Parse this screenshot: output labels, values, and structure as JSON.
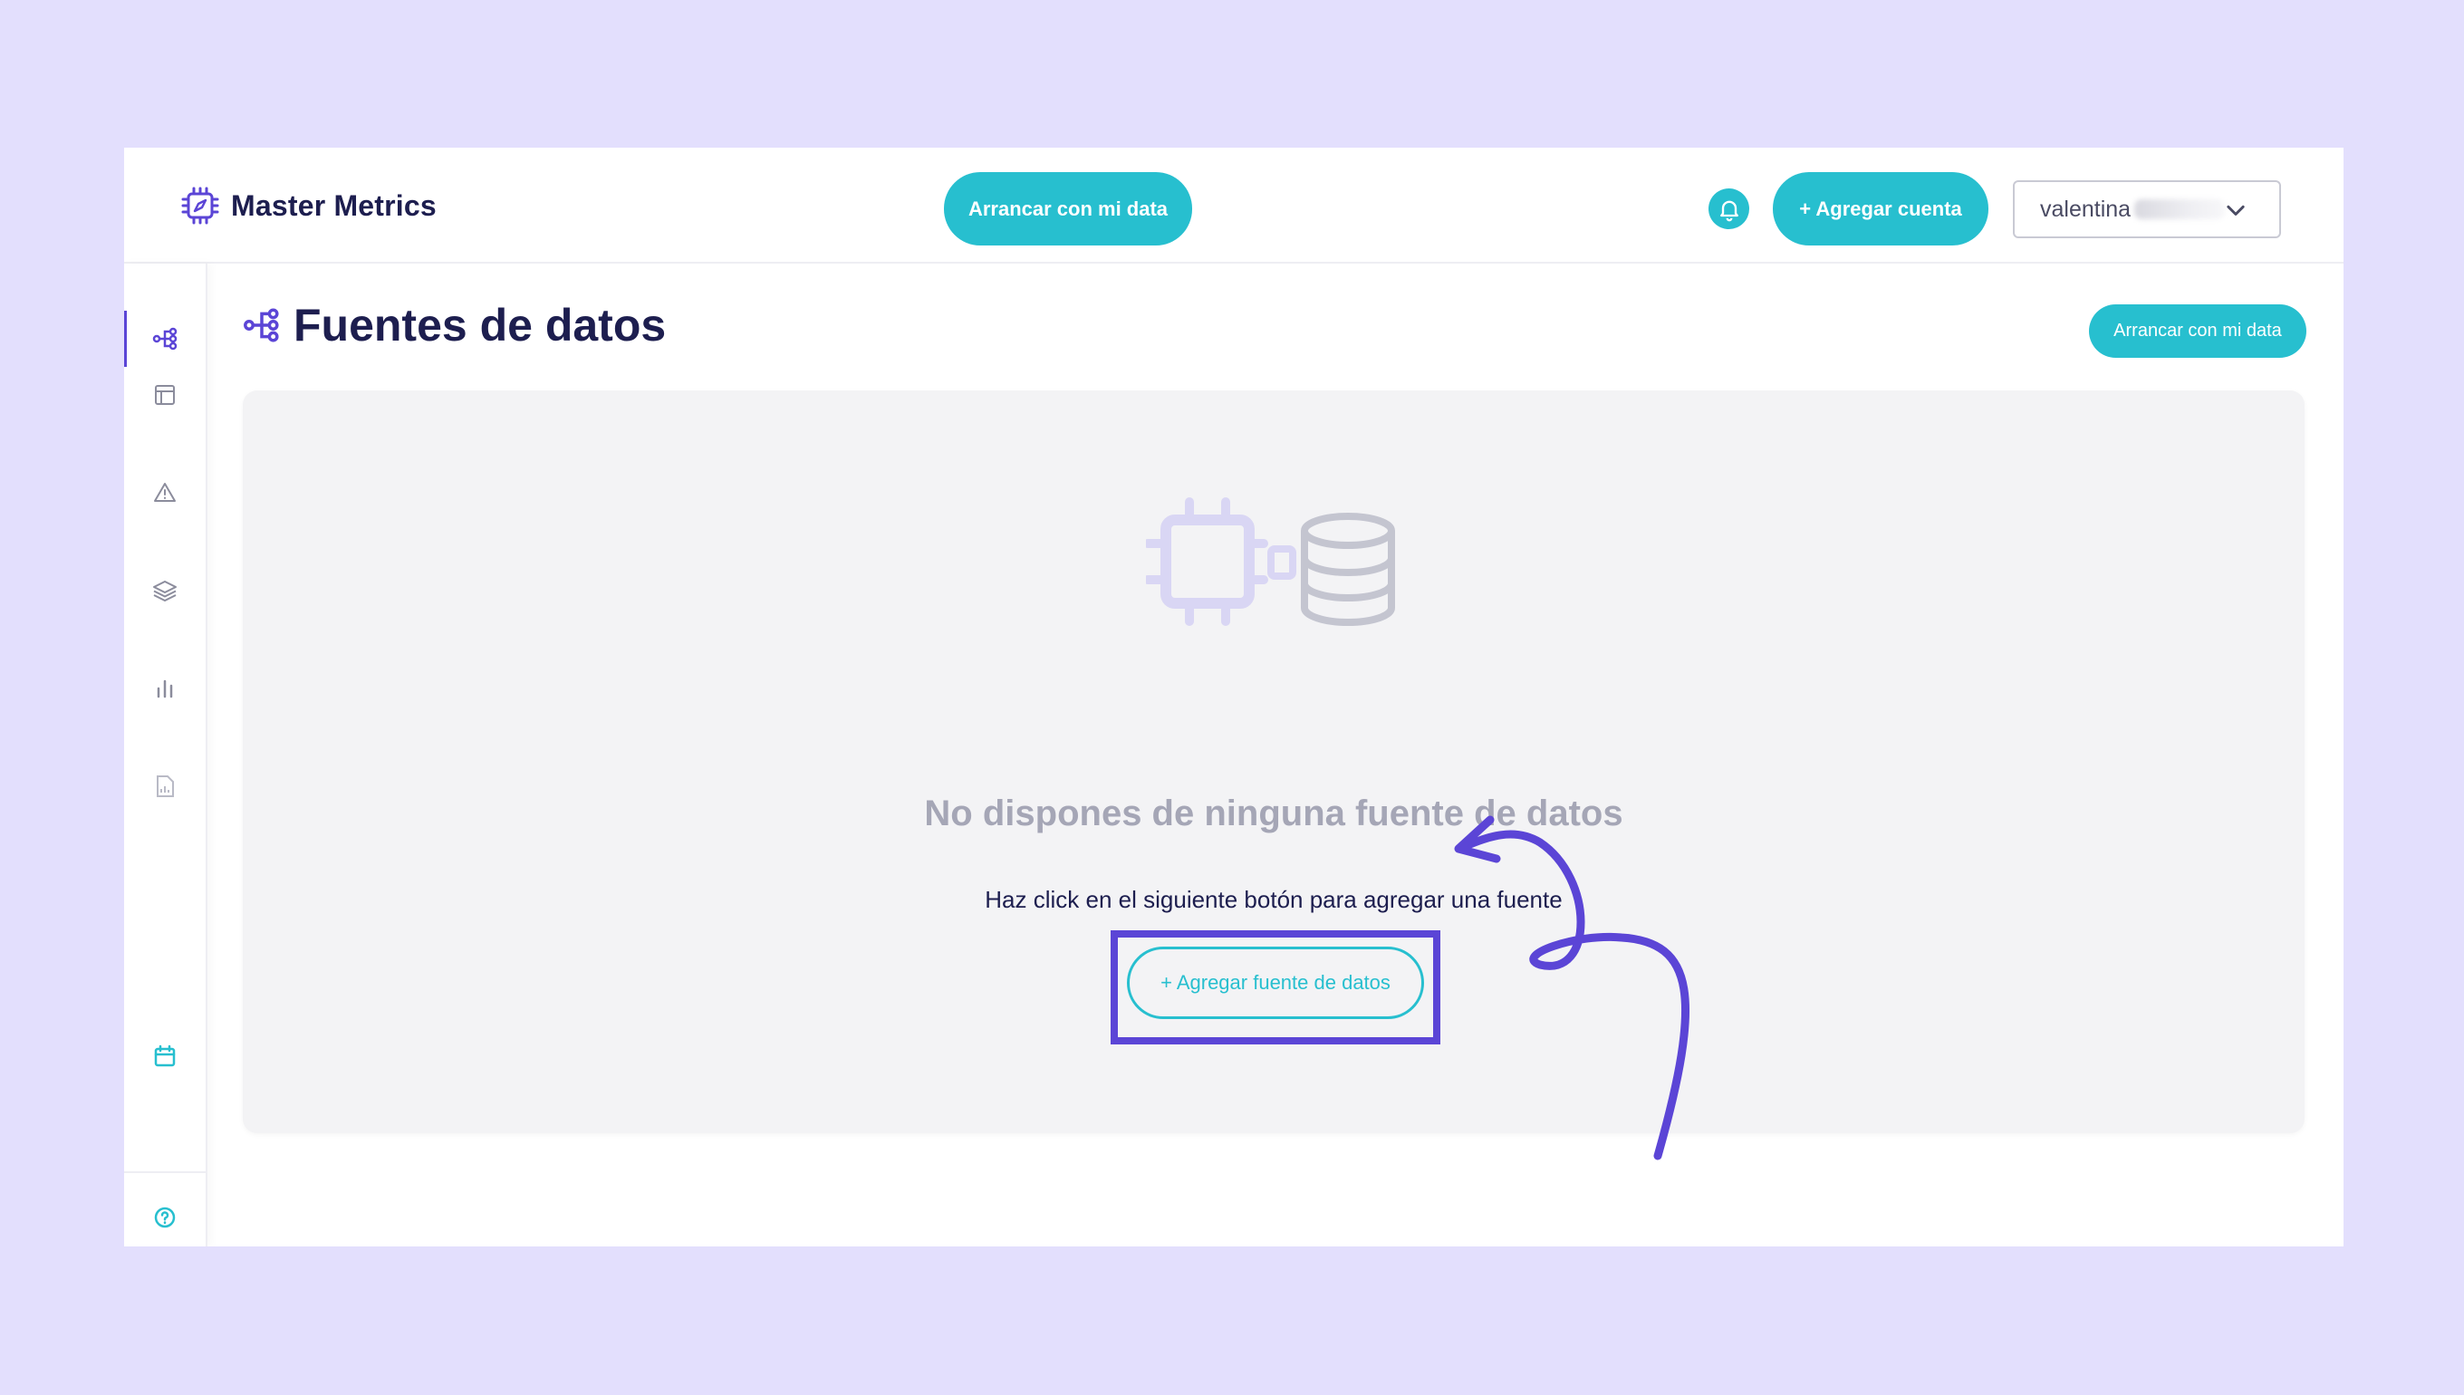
{
  "app": {
    "brand_name": "Master Metrics"
  },
  "topbar": {
    "start_button_label": "Arrancar con mi data",
    "add_account_label": "+ Agregar cuenta",
    "user_name": "valentina"
  },
  "sidebar": {
    "items": [
      {
        "icon": "data-sources-icon",
        "active": true
      },
      {
        "icon": "table-icon",
        "active": false
      },
      {
        "icon": "alert-triangle-icon",
        "active": false
      },
      {
        "icon": "layers-icon",
        "active": false
      },
      {
        "icon": "bar-chart-icon",
        "active": false
      },
      {
        "icon": "report-icon",
        "active": false
      },
      {
        "icon": "calendar-icon",
        "active": false
      },
      {
        "icon": "help-icon",
        "active": false
      }
    ]
  },
  "main": {
    "title": "Fuentes de datos",
    "start_button_label": "Arrancar con mi data",
    "empty_state": {
      "title": "No dispones de ninguna fuente de datos",
      "hint": "Haz click en el siguiente botón para agregar una fuente",
      "add_source_label": "+ Agregar fuente de datos"
    }
  },
  "colors": {
    "accent": "#27bfcf",
    "highlight": "#5b45d6",
    "background": "#e3dffd",
    "text_dark": "#1d1e4f",
    "text_muted": "#a5a6b6"
  }
}
